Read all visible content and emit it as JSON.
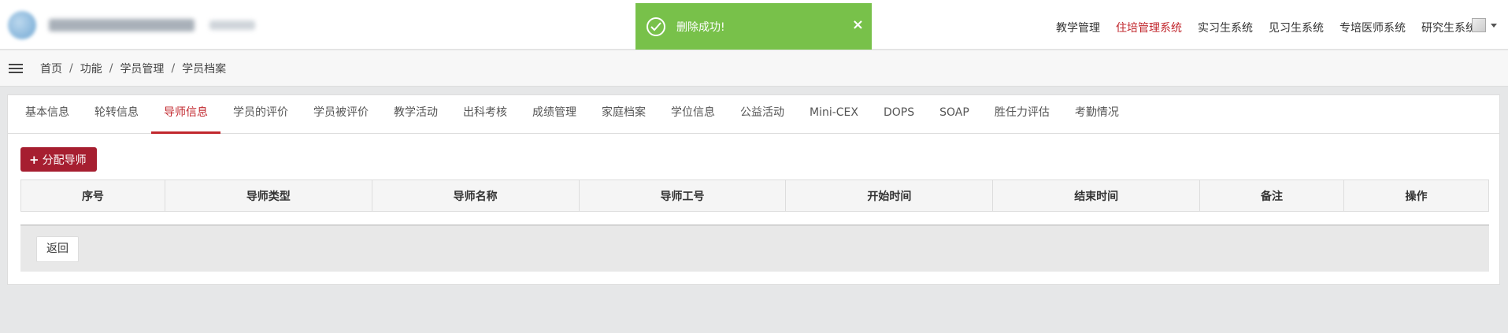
{
  "toast": {
    "message": "删除成功!",
    "close_symbol": "×"
  },
  "header": {
    "nav": [
      {
        "label": "教学管理",
        "active": false
      },
      {
        "label": "住培管理系统",
        "active": true
      },
      {
        "label": "实习生系统",
        "active": false
      },
      {
        "label": "见习生系统",
        "active": false
      },
      {
        "label": "专培医师系统",
        "active": false
      },
      {
        "label": "研究生系统",
        "active": false
      }
    ],
    "accent_color": "#c1272d"
  },
  "breadcrumb": [
    "首页",
    "功能",
    "学员管理",
    "学员档案"
  ],
  "tabs": [
    {
      "label": "基本信息",
      "active": false
    },
    {
      "label": "轮转信息",
      "active": false
    },
    {
      "label": "导师信息",
      "active": true
    },
    {
      "label": "学员的评价",
      "active": false
    },
    {
      "label": "学员被评价",
      "active": false
    },
    {
      "label": "教学活动",
      "active": false
    },
    {
      "label": "出科考核",
      "active": false
    },
    {
      "label": "成绩管理",
      "active": false
    },
    {
      "label": "家庭档案",
      "active": false
    },
    {
      "label": "学位信息",
      "active": false
    },
    {
      "label": "公益活动",
      "active": false
    },
    {
      "label": "Mini-CEX",
      "active": false
    },
    {
      "label": "DOPS",
      "active": false
    },
    {
      "label": "SOAP",
      "active": false
    },
    {
      "label": "胜任力评估",
      "active": false
    },
    {
      "label": "考勤情况",
      "active": false
    }
  ],
  "actions": {
    "assign_label": "分配导师",
    "assign_icon": "plus-icon",
    "back_label": "返回"
  },
  "table": {
    "columns": [
      "序号",
      "导师类型",
      "导师名称",
      "导师工号",
      "开始时间",
      "结束时间",
      "备注",
      "操作"
    ]
  },
  "colors": {
    "toast_bg": "#78c14a",
    "primary_button": "#a61e30"
  }
}
